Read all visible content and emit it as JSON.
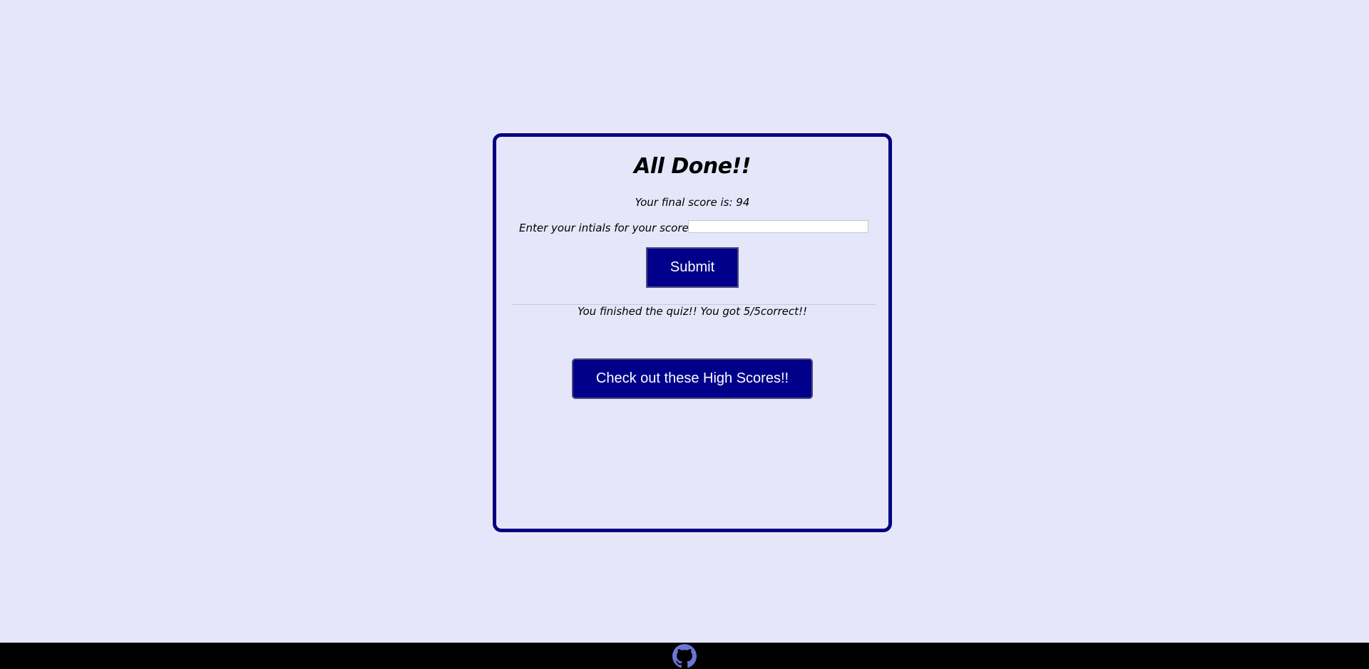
{
  "quiz_end": {
    "title": "All Done!!",
    "final_score_text": "Your final score is: 94",
    "initials_label": "Enter your intials for your score:",
    "initials_value": "",
    "submit_label": "Submit",
    "result_message": "You finished the quiz!! You got 5/5correct!!",
    "highscores_label": "Check out these High Scores!!"
  },
  "footer": {
    "icon": "github-icon"
  },
  "colors": {
    "background": "#e6e6fa",
    "accent": "#00008b",
    "footer": "#000000",
    "icon": "#6b74d6"
  }
}
